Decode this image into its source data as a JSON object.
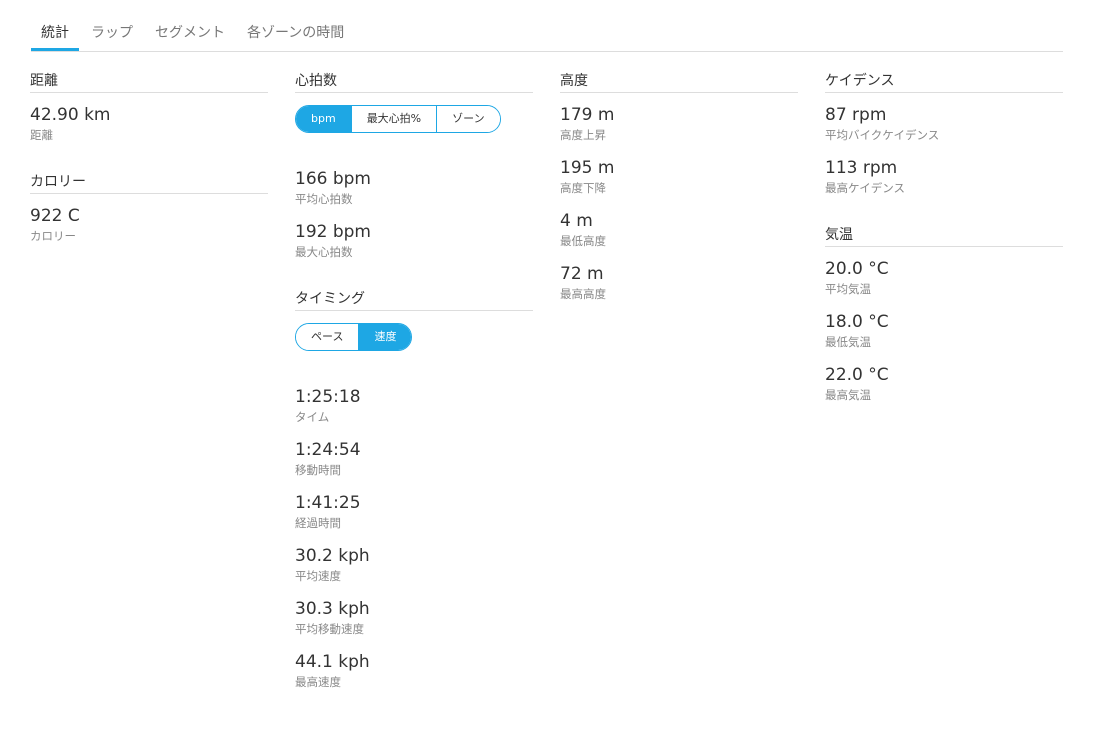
{
  "tabs": [
    {
      "label": "統計",
      "active": true
    },
    {
      "label": "ラップ",
      "active": false
    },
    {
      "label": "セグメント",
      "active": false
    },
    {
      "label": "各ゾーンの時間",
      "active": false
    }
  ],
  "distance": {
    "title": "距離",
    "stats": [
      {
        "value": "42.90 km",
        "label": "距離"
      }
    ]
  },
  "calories": {
    "title": "カロリー",
    "stats": [
      {
        "value": "922 C",
        "label": "カロリー"
      }
    ]
  },
  "heart_rate": {
    "title": "心拍数",
    "toggle": [
      {
        "label": "bpm",
        "active": true
      },
      {
        "label": "最大心拍%",
        "active": false
      },
      {
        "label": "ゾーン",
        "active": false
      }
    ],
    "stats": [
      {
        "value": "166 bpm",
        "label": "平均心拍数"
      },
      {
        "value": "192 bpm",
        "label": "最大心拍数"
      }
    ]
  },
  "timing": {
    "title": "タイミング",
    "toggle": [
      {
        "label": "ペース",
        "active": false
      },
      {
        "label": "速度",
        "active": true
      }
    ],
    "stats": [
      {
        "value": "1:25:18",
        "label": "タイム"
      },
      {
        "value": "1:24:54",
        "label": "移動時間"
      },
      {
        "value": "1:41:25",
        "label": "経過時間"
      },
      {
        "value": "30.2 kph",
        "label": "平均速度"
      },
      {
        "value": "30.3 kph",
        "label": "平均移動速度"
      },
      {
        "value": "44.1 kph",
        "label": "最高速度"
      }
    ]
  },
  "elevation": {
    "title": "高度",
    "stats": [
      {
        "value": "179 m",
        "label": "高度上昇"
      },
      {
        "value": "195 m",
        "label": "高度下降"
      },
      {
        "value": "4 m",
        "label": "最低高度"
      },
      {
        "value": "72 m",
        "label": "最高高度"
      }
    ]
  },
  "cadence": {
    "title": "ケイデンス",
    "stats": [
      {
        "value": "87 rpm",
        "label": "平均バイクケイデンス"
      },
      {
        "value": "113 rpm",
        "label": "最高ケイデンス"
      }
    ]
  },
  "temperature": {
    "title": "気温",
    "stats": [
      {
        "value": "20.0 °C",
        "label": "平均気温"
      },
      {
        "value": "18.0 °C",
        "label": "最低気温"
      },
      {
        "value": "22.0 °C",
        "label": "最高気温"
      }
    ]
  },
  "colors": {
    "accent": "#1ea7e4",
    "text": "#333333",
    "muted": "#888888",
    "divider": "#dddddd"
  }
}
